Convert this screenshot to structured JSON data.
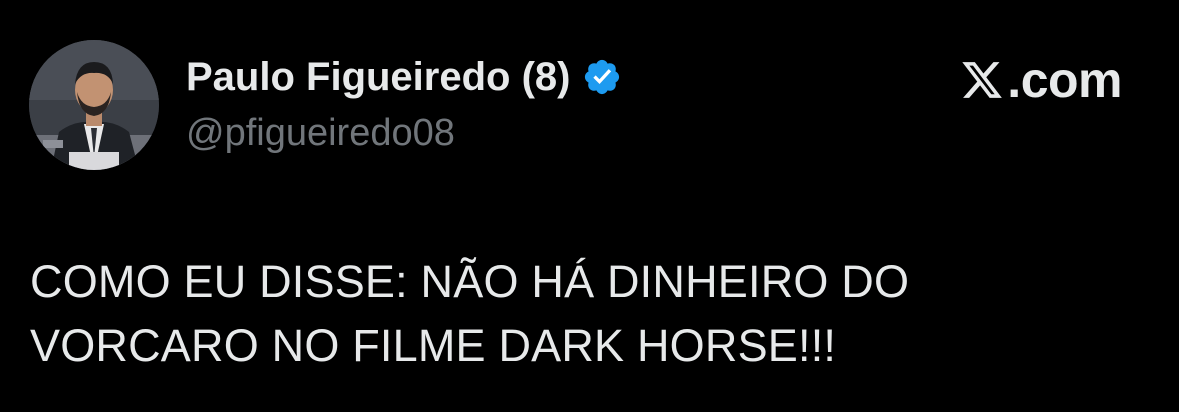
{
  "tweet": {
    "author": {
      "display_name": "Paulo Figueiredo (8)",
      "handle": "@pfigueiredo08",
      "verified": true,
      "avatar": "profile-photo"
    },
    "brand": {
      "text": ".com",
      "icon": "x-logo-icon"
    },
    "text": "COMO EU DISSE: NÃO HÁ DINHEIRO DO\nVORCARO NO FILME DARK HORSE!!!"
  },
  "colors": {
    "background": "#000000",
    "primary_text": "#e7e9ea",
    "secondary_text": "#71767b",
    "verified_badge": "#1d9bf0"
  }
}
